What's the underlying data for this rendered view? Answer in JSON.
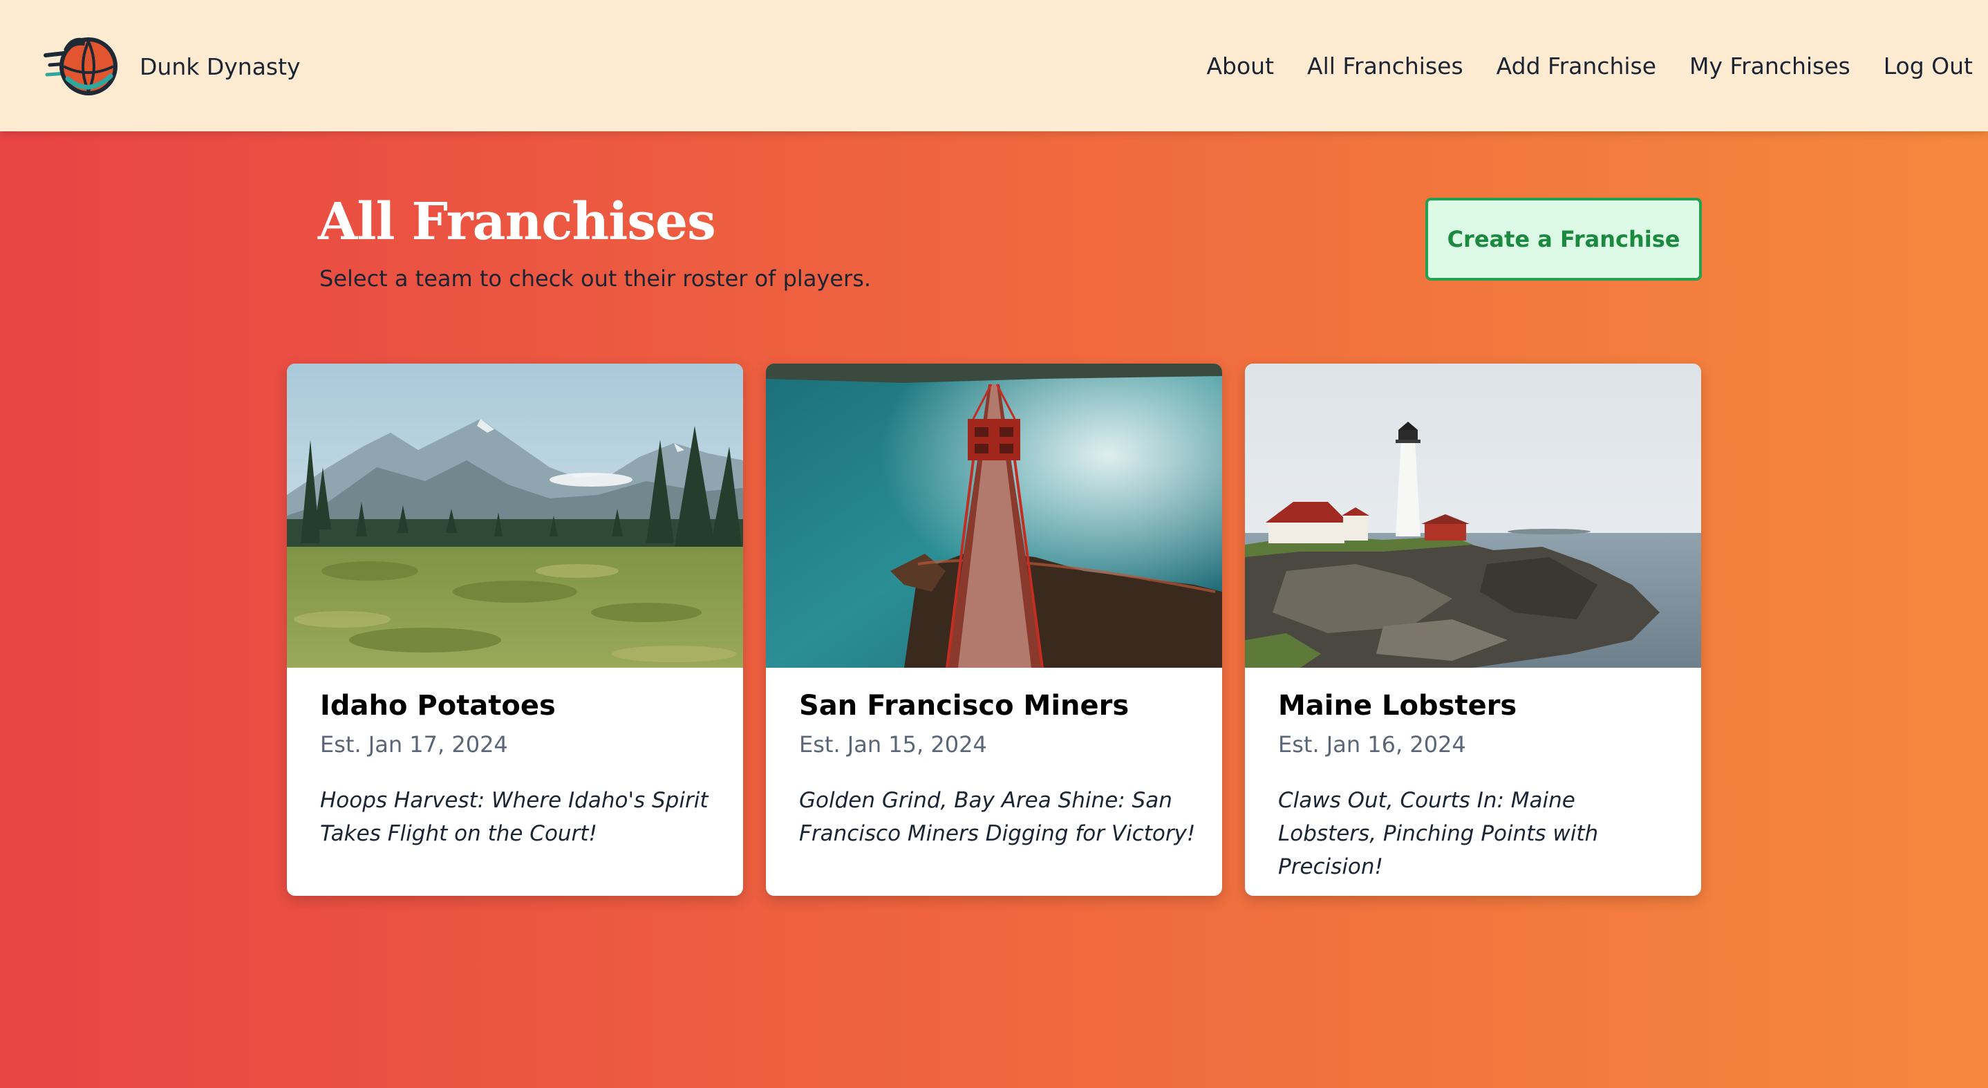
{
  "app": {
    "name": "Dunk Dynasty",
    "logo_icon": "basketball-logo-icon"
  },
  "nav": {
    "items": [
      {
        "label": "About"
      },
      {
        "label": "All Franchises"
      },
      {
        "label": "Add Franchise"
      },
      {
        "label": "My Franchises"
      },
      {
        "label": "Log Out"
      }
    ]
  },
  "page": {
    "title": "All Franchises",
    "subtitle": "Select a team to check out their roster of players.",
    "create_button": "Create a Franchise"
  },
  "franchises": [
    {
      "name": "Idaho Potatoes",
      "established": "Est. Jan 17, 2024",
      "tagline": "Hoops Harvest: Where Idaho's Spirit Takes Flight on the Court!",
      "image": "mountain-meadow-photo"
    },
    {
      "name": "San Francisco Miners",
      "established": "Est. Jan 15, 2024",
      "tagline": "Golden Grind, Bay Area Shine: San Francisco Miners Digging for Victory!",
      "image": "golden-gate-bridge-photo"
    },
    {
      "name": "Maine Lobsters",
      "established": "Est. Jan 16, 2024",
      "tagline": "Claws Out, Courts In: Maine Lobsters, Pinching Points with Precision!",
      "image": "lighthouse-coast-photo"
    }
  ],
  "colors": {
    "header_bg": "#feebd1",
    "gradient_start": "#e84444",
    "gradient_end": "#f5883e",
    "button_bg": "#dcfae5",
    "button_border": "#22a150",
    "text_dark": "#1b2433"
  }
}
